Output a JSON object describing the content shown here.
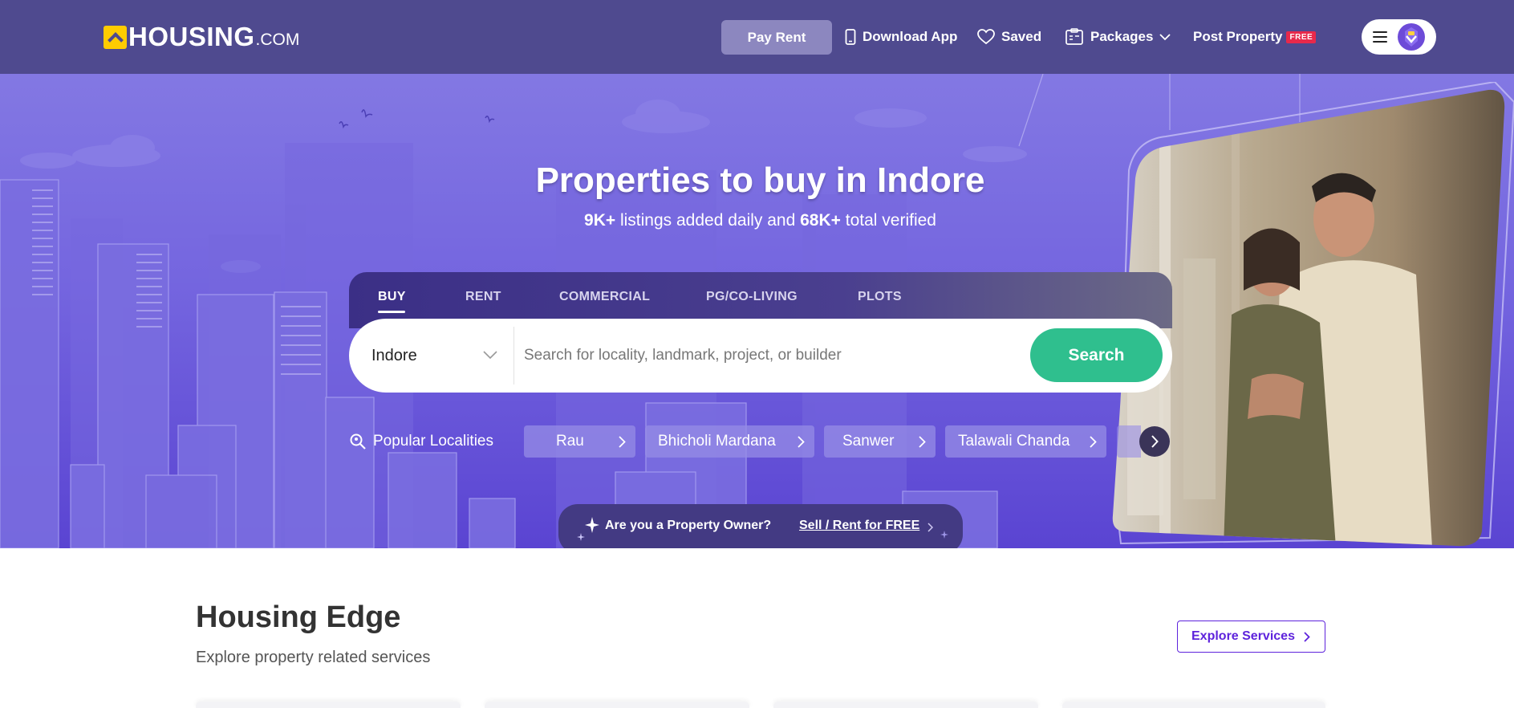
{
  "header": {
    "logo_text": "HOUSING",
    "logo_suffix": ".COM",
    "pay_rent": "Pay Rent",
    "download_app": "Download App",
    "saved": "Saved",
    "packages": "Packages",
    "post_property": "Post Property",
    "free_badge": "FREE"
  },
  "hero": {
    "title": "Properties to buy in Indore",
    "subtitle_count1": "9K+",
    "subtitle_mid": " listings added daily and ",
    "subtitle_count2": "68K+",
    "subtitle_end": " total verified"
  },
  "search": {
    "tabs": [
      "BUY",
      "RENT",
      "COMMERCIAL",
      "PG/CO-LIVING",
      "PLOTS"
    ],
    "active_tab": "BUY",
    "city": "Indore",
    "placeholder": "Search for locality, landmark, project, or builder",
    "button": "Search"
  },
  "popular": {
    "label": "Popular Localities",
    "chips": [
      "Rau",
      "Bhicholi Mardana",
      "Sanwer",
      "Talawali Chanda"
    ]
  },
  "owner": {
    "question": "Are you a Property Owner?",
    "link": "Sell / Rent for FREE"
  },
  "edge": {
    "title": "Housing Edge",
    "subtitle": "Explore property related services",
    "explore_button": "Explore Services"
  },
  "colors": {
    "header_bg": "#4f4a8f",
    "hero_bg": "#7465df",
    "search_green": "#2fbf8e",
    "accent_purple": "#5e23dc",
    "free_red": "#e8294b",
    "logo_yellow": "#ffcc00"
  },
  "icons": {
    "download_app": "phone-icon",
    "saved": "heart-icon",
    "packages": "clipboard-icon",
    "popular": "location-search-icon"
  }
}
